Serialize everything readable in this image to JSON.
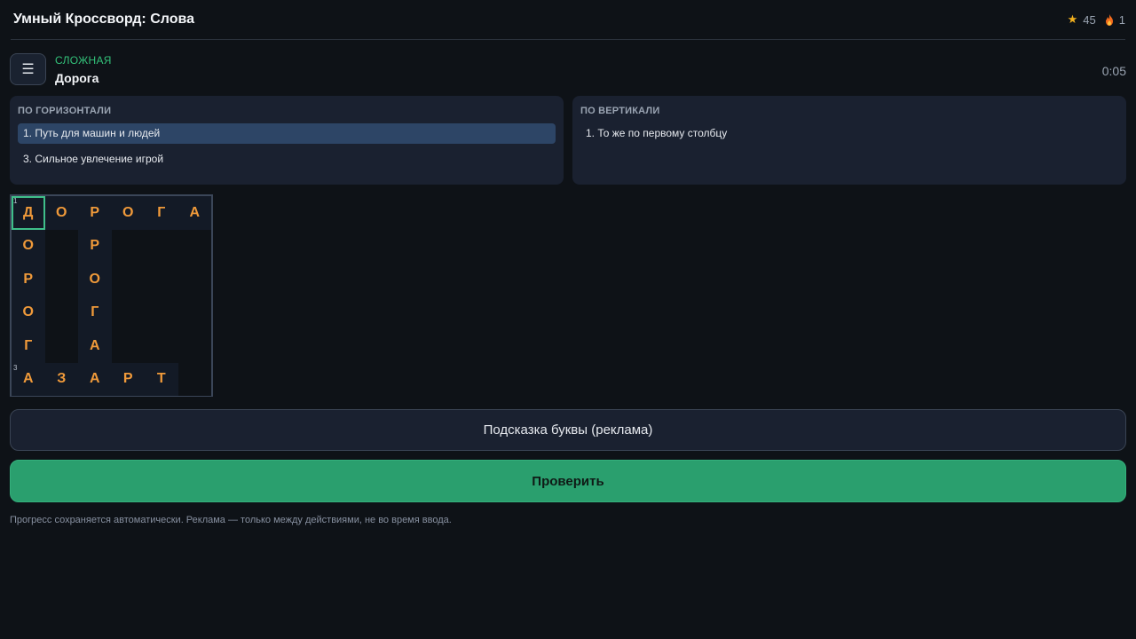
{
  "header": {
    "title": "Умный Кроссворд: Слова",
    "stars": "45",
    "streak": "1",
    "icons": {
      "stars": "star-icon",
      "streak": "fire-icon"
    }
  },
  "level": {
    "menu_icon": "☰",
    "difficulty": "СЛОЖНАЯ",
    "name": "Дорога",
    "timer": "0:05"
  },
  "clues": {
    "across_heading": "ПО ГОРИЗОНТАЛИ",
    "across": [
      {
        "label": "1. Путь для машин и людей",
        "active": true
      },
      {
        "label": "3. Сильное увлечение игрой",
        "active": false
      }
    ],
    "down_heading": "ПО ВЕРТИКАЛИ",
    "down": [
      {
        "label": "1. То же по первому столбцу",
        "active": false
      }
    ]
  },
  "grid": {
    "rows": [
      [
        "Д",
        "О",
        "Р",
        "О",
        "Г",
        "А"
      ],
      [
        "О",
        "",
        "Р",
        "",
        "",
        ""
      ],
      [
        "Р",
        "",
        "О",
        "",
        "",
        ""
      ],
      [
        "О",
        "",
        "Г",
        "",
        "",
        ""
      ],
      [
        "Г",
        "",
        "А",
        "",
        "",
        ""
      ],
      [
        "А",
        "З",
        "А",
        "Р",
        "Т",
        ""
      ]
    ],
    "numbers": {
      "0-0": "1",
      "5-0": "3"
    },
    "selected": "0-0"
  },
  "actions": {
    "hint_label": "Подсказка буквы (реклама)",
    "check_label": "Проверить"
  },
  "footnote": "Прогресс сохраняется автоматически. Реклама — только между действиями, не во время ввода.",
  "colors": {
    "accent_green": "#2a9f6e",
    "letter": "#f09a3a",
    "difficulty": "#33c27a",
    "active_clue": "#2d4566"
  }
}
